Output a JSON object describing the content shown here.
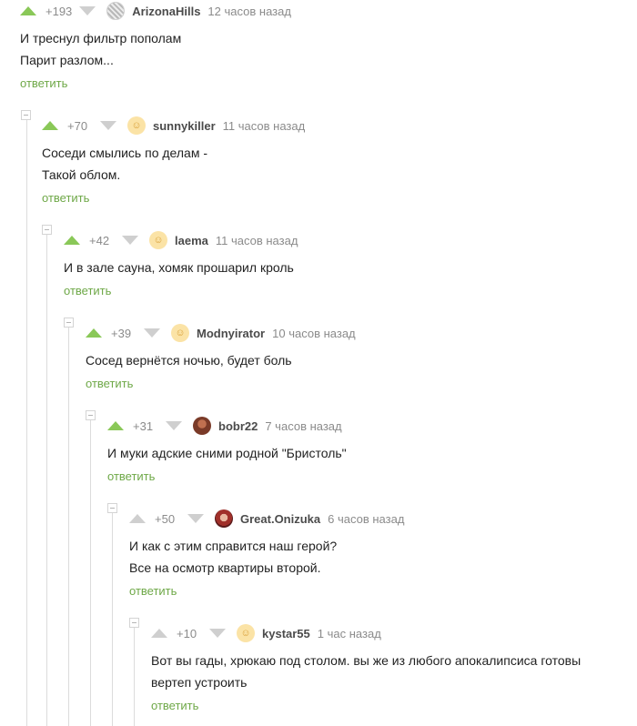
{
  "comments": [
    {
      "rating": "+193",
      "author": "ArizonaHills",
      "time": "12 часов назад",
      "lines": [
        "И треснул фильтр пополам",
        "Парит разлом..."
      ],
      "reply": "ответить",
      "upvoted": true,
      "avatar": "pattern-avatar"
    },
    {
      "rating": "+70",
      "author": "sunnykiller",
      "time": "11 часов назад",
      "lines": [
        "Соседи смылись по делам -",
        "Такой облом."
      ],
      "reply": "ответить",
      "upvoted": true,
      "avatar": "smiley-avatar"
    },
    {
      "rating": "+42",
      "author": "laema",
      "time": "11 часов назад",
      "lines": [
        "И в зале сауна, хомяк прошарил кроль"
      ],
      "reply": "ответить",
      "upvoted": true,
      "avatar": "smiley-avatar"
    },
    {
      "rating": "+39",
      "author": "Modnyirator",
      "time": "10 часов назад",
      "lines": [
        "Сосед вернётся ночью, будет боль"
      ],
      "reply": "ответить",
      "upvoted": true,
      "avatar": "smiley-avatar"
    },
    {
      "rating": "+31",
      "author": "bobr22",
      "time": "7 часов назад",
      "lines": [
        "И муки адские сними родной \"Бристоль\""
      ],
      "reply": "ответить",
      "upvoted": true,
      "avatar": "photo-avatar"
    },
    {
      "rating": "+50",
      "author": "Great.Onizuka",
      "time": "6 часов назад",
      "lines": [
        "И как с этим справится наш герой?",
        "Все на осмотр квартиры второй."
      ],
      "reply": "ответить",
      "upvoted": false,
      "avatar": "photo-avatar"
    },
    {
      "rating": "+10",
      "author": "kystar55",
      "time": "1 час назад",
      "lines": [
        "Вот вы гады, хрюкаю под столом. вы же из любого апокалипсиса готовы",
        "вертеп устроить"
      ],
      "reply": "ответить",
      "upvoted": false,
      "avatar": "smiley-avatar"
    }
  ],
  "colors": {
    "upvote": "#8ac858",
    "inactive": "#cfcfcf",
    "reply": "#6ea847",
    "meta": "#8b8b8b"
  }
}
